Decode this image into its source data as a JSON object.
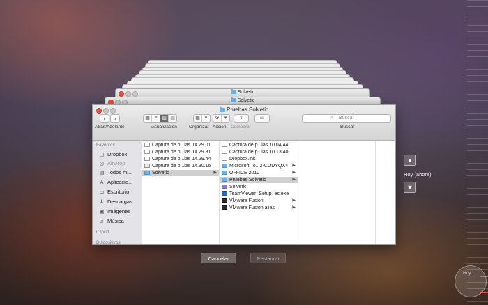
{
  "background_windows": [
    {
      "title": "Solvetic"
    },
    {
      "title": "Solvetic"
    }
  ],
  "window": {
    "title": "Pruebas Solvetic",
    "toolbar": {
      "back": "‹",
      "forward": "›",
      "nav_label": "Atrás/Adelante",
      "view_label": "Visualización",
      "arrange_label": "Organizar",
      "action_label": "Acción",
      "share_label": "Compartir",
      "search_placeholder": "Buscar",
      "search_label": "Buscar"
    },
    "sidebar": {
      "favorites_header": "Favoritos",
      "items": [
        {
          "icon": "dropbox-icon",
          "label": "Dropbox"
        },
        {
          "icon": "airdrop-icon",
          "label": "AirDrop"
        },
        {
          "icon": "all-files-icon",
          "label": "Todos mi..."
        },
        {
          "icon": "applications-icon",
          "label": "Aplicacio..."
        },
        {
          "icon": "desktop-icon",
          "label": "Escritorio"
        },
        {
          "icon": "downloads-icon",
          "label": "Descargas"
        },
        {
          "icon": "images-icon",
          "label": "Imágenes"
        },
        {
          "icon": "music-icon",
          "label": "Música"
        }
      ],
      "icloud_header": "iCloud",
      "devices_header": "Dispositivos"
    },
    "column1": [
      {
        "label": "Captura de p...las 14.29.01"
      },
      {
        "label": "Captura de p...las 14.29.31"
      },
      {
        "label": "Captura de p...las 14.29.44"
      },
      {
        "label": "Captura de p...las 14.30.16"
      },
      {
        "label": "Solvetic"
      }
    ],
    "column2": [
      {
        "label": "Captura de p...las 10.04.44"
      },
      {
        "label": "Captura de p...las 10.13.40"
      },
      {
        "label": "Dropbox.lnk"
      },
      {
        "label": "Microsoft.To...2-CODYQX4"
      },
      {
        "label": "OFFICE 2010"
      },
      {
        "label": "Pruebas Solvetic"
      },
      {
        "label": "Solvetic"
      },
      {
        "label": "TeamViewer_Setup_es.exe"
      },
      {
        "label": "VMware Fusion"
      },
      {
        "label": "VMware Fusion alias"
      }
    ]
  },
  "timemachine": {
    "up": "▲",
    "down": "▼",
    "now_label": "Hoy (ahora)",
    "cancel_label": "Cancelar",
    "restore_label": "Restaurar"
  },
  "watermark": {
    "label": "Hoy"
  }
}
